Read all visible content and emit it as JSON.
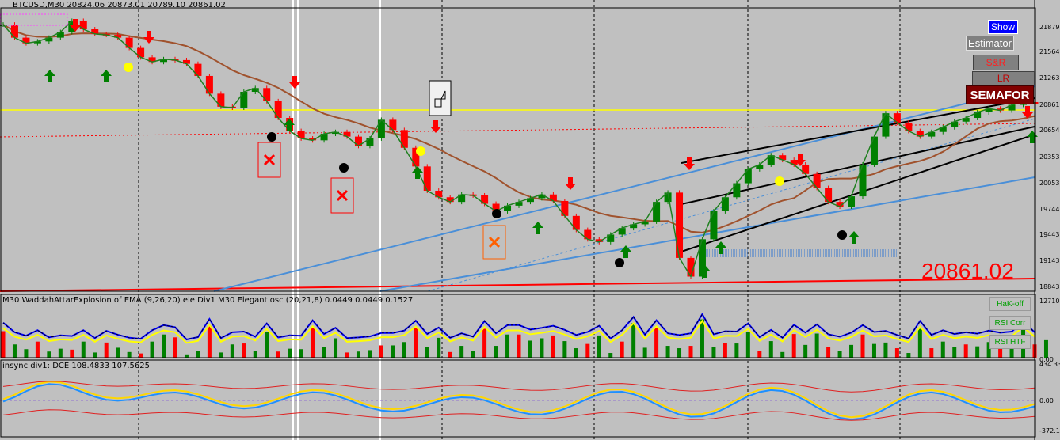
{
  "panels": {
    "main": {
      "title": "BTCUSD,M30  20824.06 20873.01 20789.10 20861.02",
      "last_price": "20861.02"
    },
    "osc1": {
      "title": "M30 WaddahAttarExplosion of EMA (9,26,20)  ele Div1 M30 Elegant osc (20,21,8) 0.0449 0.0449 0.1527"
    },
    "osc2": {
      "title": "insync div1:  DCE 108.4833 107.5625"
    }
  },
  "buttons": {
    "show": "Show",
    "estimator": "Estimator",
    "sr": "S&R",
    "lr": "LR",
    "semafor": "SEMAFOR",
    "hak": "HaK-off",
    "rsi_corr": "RSI Corr",
    "rsi_htf": "RSI HTF"
  },
  "colors": {
    "show_bg": "#0000ff",
    "semafor_bg": "#800000",
    "price_line": "#ffff00",
    "hak_text": "#00a000"
  },
  "axes": {
    "main_ticks": [
      "21879",
      "21564",
      "21263",
      "20861",
      "20654",
      "20353",
      "20053",
      "19744",
      "19443",
      "19143",
      "18843"
    ],
    "osc1_ticks": [
      "12710.5",
      "0.00"
    ],
    "osc2_ticks": [
      "434.33",
      "0.00",
      "-372.1"
    ]
  },
  "chart_data": [
    {
      "type": "line",
      "ylim": [
        18843,
        21879
      ],
      "series": [
        {
          "name": "BTCUSD,M30",
          "values": [
            21700,
            21560,
            21500,
            21520,
            21560,
            21620,
            21740,
            21650,
            21600,
            21590,
            21560,
            21450,
            21350,
            21300,
            21330,
            21320,
            21280,
            21150,
            20960,
            20820,
            20810,
            20980,
            21020,
            20880,
            20700,
            20560,
            20480,
            20460,
            20530,
            20550,
            20500,
            20400,
            20480,
            20680,
            20570,
            20380,
            20180,
            19920,
            19850,
            19800,
            19880,
            19870,
            19780,
            19700,
            19760,
            19800,
            19840,
            19880,
            19810,
            19650,
            19500,
            19400,
            19370,
            19450,
            19520,
            19560,
            19590,
            19800,
            19900,
            19200,
            19000,
            19400,
            19700,
            19850,
            20000,
            20150,
            20200,
            20300,
            20250,
            20200,
            20100,
            19950,
            19800,
            19750,
            19860,
            20200,
            20500,
            20750,
            20650,
            20560,
            20500,
            20550,
            20600,
            20660,
            20700,
            20760,
            20800,
            20780,
            20840,
            20870,
            20861
          ]
        }
      ]
    },
    {
      "type": "bar",
      "ylim": [
        0,
        12710.5
      ],
      "series": [
        {
          "name": "",
          "values": [
            5600,
            2800,
            1800,
            3400,
            1300,
            1900,
            1700,
            3400,
            1100,
            3200,
            2100,
            1200,
            900,
            3400,
            4900,
            4300,
            700,
            1400,
            6700,
            1100,
            2800,
            3000,
            1500,
            5400,
            1300,
            1900,
            1800,
            6300,
            2300,
            4100,
            1100,
            1300,
            1600,
            2600,
            2600,
            3300,
            6200,
            2300,
            4200,
            1200,
            2500,
            1500,
            6100,
            2500,
            4900,
            4900,
            3600,
            4100,
            4700,
            3500,
            2000,
            2900,
            4700,
            1000,
            3400,
            7300,
            2100,
            6300,
            2500,
            2000,
            2500,
            8100,
            2200,
            3100,
            3000,
            5400,
            1400,
            3500,
            1200,
            5000,
            2700,
            5100,
            2200,
            1500,
            2700,
            4900,
            2900,
            3200,
            2000,
            1000,
            6100,
            2000,
            3400,
            2300,
            2800,
            2400,
            3300,
            2700,
            3000,
            6000,
            2800,
            3700
          ]
        }
      ]
    },
    {
      "type": "line",
      "ylim": [
        -372.1,
        434.33
      ],
      "series": [
        {
          "name": "",
          "values": [
            23,
            71,
            132,
            183,
            207,
            199,
            165,
            118,
            73,
            42,
            32,
            42,
            65,
            92,
            112,
            118,
            105,
            75,
            34,
            -7,
            -38,
            -50,
            -40,
            -11,
            30,
            72,
            105,
            120,
            114,
            87,
            45,
            -2,
            -43,
            -71,
            -81,
            -72,
            -46,
            -10,
            27,
            56,
            69,
            63,
            37,
            -3,
            -48,
            -86,
            -109,
            -112,
            -92,
            -53,
            -2,
            52,
            98,
            125,
            127,
            101,
            53,
            -6,
            -66,
            -112,
            -136,
            -132,
            -101,
            -47,
            18,
            79,
            124,
            144,
            134,
            95,
            34,
            -37,
            -102,
            -148,
            -166,
            -153,
            -112,
            -51,
            14,
            71,
            108,
            119,
            102,
            63,
            13,
            -35,
            -72,
            -89,
            -85,
            -61,
            -27
          ]
        }
      ]
    }
  ]
}
